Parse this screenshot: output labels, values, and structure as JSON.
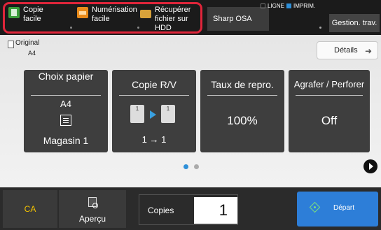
{
  "quick_buttons": [
    {
      "line1": "Copie",
      "line2": "facile",
      "icon": "copy-icon"
    },
    {
      "line1": "Numérisation",
      "line2": "facile",
      "icon": "scan-icon"
    },
    {
      "line1": "Récupérer",
      "line2": "fichier sur HDD",
      "icon": "folder-icon"
    }
  ],
  "top_bar": {
    "osa_label": "Sharp OSA",
    "status_line": "LIGNE",
    "status_print": "IMPRIM.",
    "job_status_label": "Gestion. trav."
  },
  "original": {
    "label": "Original",
    "size": "A4"
  },
  "details_label": "Détails",
  "tiles": {
    "paper": {
      "title": "Choix papier",
      "size": "A4",
      "tray": "Magasin 1"
    },
    "duplex": {
      "title": "Copie R/V",
      "value": "1 → 1",
      "page_label": "1"
    },
    "ratio": {
      "title": "Taux de repro.",
      "value": "100%"
    },
    "finish": {
      "title": "Agrafer / Perforer",
      "value": "Off"
    }
  },
  "pagination": {
    "current": 1,
    "total": 2
  },
  "bottom_bar": {
    "ca_label": "CA",
    "preview_label": "Aperçu",
    "copies_label": "Copies",
    "copies_value": "1",
    "start_label": "Départ"
  },
  "colors": {
    "highlight": "#e0253a",
    "accent_blue": "#2e8fd8",
    "ca_yellow": "#f3c200"
  }
}
